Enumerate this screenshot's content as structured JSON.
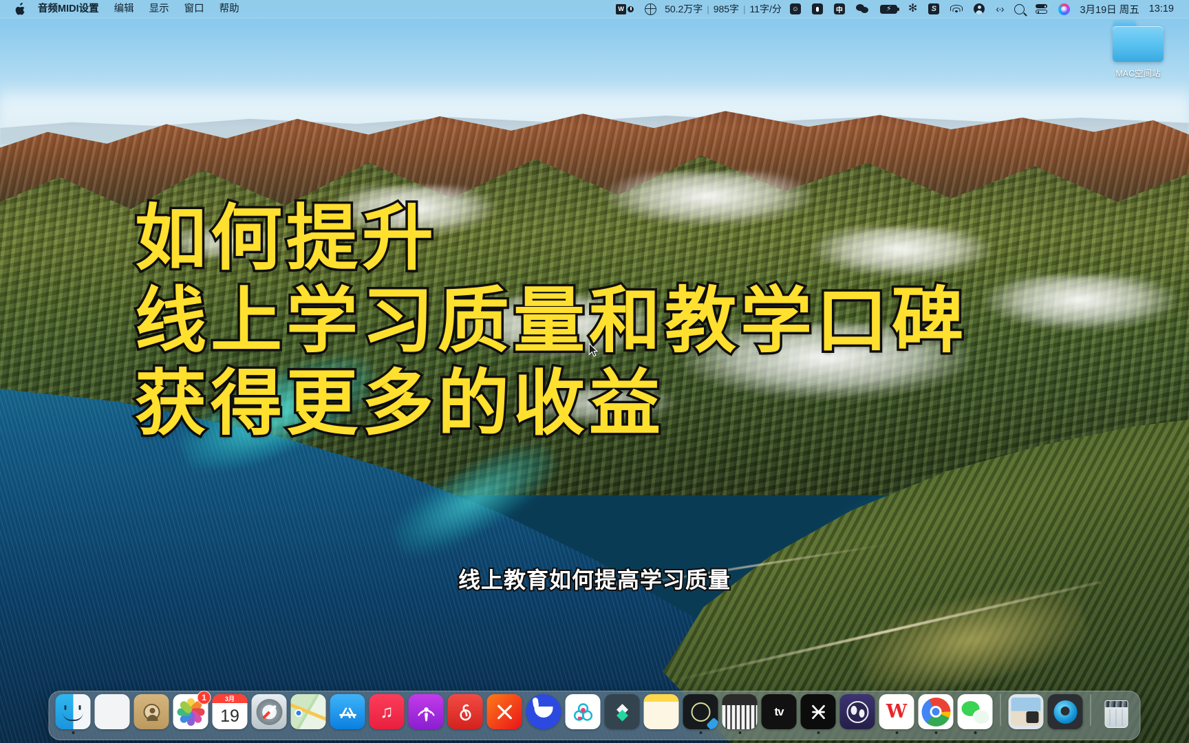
{
  "menubar": {
    "apple_icon": "apple-logo-icon",
    "app_name": "音频MIDI设置",
    "menus": [
      "编辑",
      "显示",
      "窗口",
      "帮助"
    ],
    "status": {
      "wps_icon": "wps-office-icon",
      "wps_badge_icon": "notification-badge-icon",
      "globe_icon": "translate-globe-icon",
      "total_words": "50.2万字",
      "session_words": "985字",
      "typing_speed": "11字/分",
      "emoji_icon": "emoji-picker-icon",
      "mic_icon": "microphone-icon",
      "ime_label": "中",
      "wechat_icon": "wechat-icon",
      "battery_icon": "battery-charging-icon",
      "bluetooth_icon": "bluetooth-icon",
      "sogou_icon": "sogou-input-icon",
      "wifi_icon": "wifi-icon",
      "account_icon": "user-account-icon",
      "code_icon": "code-brackets-icon",
      "search_icon": "spotlight-search-icon",
      "control_center_icon": "control-center-icon",
      "siri_icon": "siri-icon",
      "date": "3月19日 周五",
      "time": "13:19"
    }
  },
  "desktop": {
    "icons": [
      {
        "name": "MAC空间站",
        "icon": "folder-icon"
      }
    ]
  },
  "overlay": {
    "title_lines": [
      "如何提升",
      "线上学习质量和教学口碑",
      "获得更多的收益"
    ],
    "title_color": "#FFE02E",
    "title_outline_color": "#111111",
    "subtitle": "线上教育如何提高学习质量",
    "subtitle_color": "#FFFFFF"
  },
  "dock": {
    "items": [
      {
        "label": "访达",
        "icon": "finder-icon",
        "running": true,
        "badge": ""
      },
      {
        "label": "启动台",
        "icon": "launchpad-icon",
        "running": false,
        "badge": ""
      },
      {
        "label": "通讯录",
        "icon": "contacts-icon",
        "running": false,
        "badge": ""
      },
      {
        "label": "照片",
        "icon": "photos-icon",
        "running": false,
        "badge": "1"
      },
      {
        "label": "日历",
        "icon": "calendar-icon",
        "running": false,
        "badge": "",
        "month": "3月",
        "day": "19"
      },
      {
        "label": "Safari浏览器",
        "icon": "safari-icon",
        "running": false,
        "badge": ""
      },
      {
        "label": "地图",
        "icon": "maps-icon",
        "running": false,
        "badge": ""
      },
      {
        "label": "App Store",
        "icon": "app-store-icon",
        "running": false,
        "badge": ""
      },
      {
        "label": "音乐",
        "icon": "music-icon",
        "running": false,
        "badge": ""
      },
      {
        "label": "播客",
        "icon": "podcasts-icon",
        "running": false,
        "badge": ""
      },
      {
        "label": "网易云音乐",
        "icon": "netease-music-icon",
        "running": false,
        "badge": ""
      },
      {
        "label": "XMind",
        "icon": "xmind-icon",
        "running": false,
        "badge": ""
      },
      {
        "label": "得到",
        "icon": "dedao-duck-icon",
        "running": false,
        "badge": ""
      },
      {
        "label": "美图",
        "icon": "flower-app-icon",
        "running": false,
        "badge": ""
      },
      {
        "label": "Keynote",
        "icon": "green-diamond-icon",
        "running": false,
        "badge": ""
      },
      {
        "label": "备忘录",
        "icon": "notes-icon",
        "running": false,
        "badge": ""
      },
      {
        "label": "逻辑乐队",
        "icon": "logic-pro-icon",
        "running": true,
        "badge": ""
      },
      {
        "label": "音频MIDI设置",
        "icon": "midi-keyboard-icon",
        "running": true,
        "badge": ""
      },
      {
        "label": "Apple TV",
        "icon": "apple-tv-icon",
        "running": false,
        "badge": ""
      },
      {
        "label": "剪映",
        "icon": "capcut-icon",
        "running": true,
        "badge": ""
      },
      {
        "label": "OBS",
        "icon": "obs-studio-icon",
        "running": false,
        "badge": ""
      },
      {
        "label": "WPS Office",
        "icon": "wps-office-icon",
        "running": true,
        "badge": ""
      },
      {
        "label": "Google Chrome",
        "icon": "chrome-icon",
        "running": true,
        "badge": ""
      },
      {
        "label": "微信",
        "icon": "wechat-app-icon",
        "running": true,
        "badge": ""
      }
    ],
    "right_items": [
      {
        "label": "图片堆栈",
        "icon": "stack-folder-icon"
      },
      {
        "label": "QuickTime Player",
        "icon": "quicktime-icon"
      }
    ],
    "trash": {
      "label": "废纸篓",
      "icon": "trash-full-icon"
    }
  }
}
